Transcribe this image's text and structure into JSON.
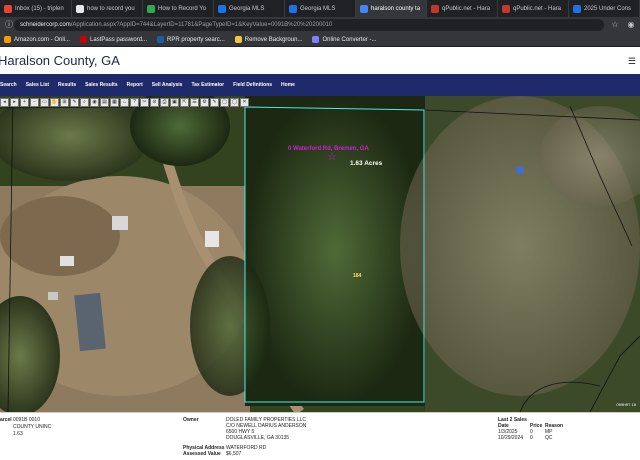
{
  "browser": {
    "tabs": [
      {
        "label": "Inbox (15) - triplen",
        "color": "#ea4335",
        "active": false
      },
      {
        "label": "how to record you",
        "color": "#e8e8e8",
        "active": false
      },
      {
        "label": "How to Record Yo",
        "color": "#34a853",
        "active": false
      },
      {
        "label": "Georgia MLS",
        "color": "#1a73e8",
        "active": false
      },
      {
        "label": "Georgia MLS",
        "color": "#1a73e8",
        "active": false
      },
      {
        "label": "haralson county ta",
        "color": "#4285f4",
        "active": true
      },
      {
        "label": "qPublic.net - Hara",
        "color": "#c0392b",
        "active": false
      },
      {
        "label": "qPublic.net - Hara",
        "color": "#c0392b",
        "active": false
      },
      {
        "label": "2025 Under Cons",
        "color": "#1a73e8",
        "active": false
      }
    ],
    "url_host": "schneidercorp.com",
    "url_path": "/Application.aspx?AppID=744&LayerID=11781&PageTypeID=1&KeyValue=0091B%20%20200010",
    "bookmarks": [
      {
        "label": "Amazon.com - Onli...",
        "color": "#ff9900"
      },
      {
        "label": "LastPass password...",
        "color": "#cc0000"
      },
      {
        "label": "RPR property searc...",
        "color": "#1a5fa6"
      },
      {
        "label": "Remove Backgroun...",
        "color": "#f6c445"
      },
      {
        "label": "Online Converter -...",
        "color": "#7f7fff"
      }
    ]
  },
  "site": {
    "title": "Haralson County, GA",
    "nav": [
      "Search",
      "Sales List",
      "Results",
      "Sales Results",
      "Report",
      "Sell Analysis",
      "Tax Estimator",
      "Field Definitions",
      "Home"
    ]
  },
  "map": {
    "tools": [
      "◂",
      "▸",
      "+",
      "−",
      "▭",
      "✋",
      "⊞",
      "✎",
      "⌕",
      "◉",
      "▤",
      "▦",
      "⌂",
      "?",
      "✂",
      "⊘",
      "⎙",
      "▣",
      "⇱",
      "☰",
      "⚙",
      "✎",
      "▢",
      "◯",
      "✕"
    ],
    "parcel_label": "0 Waterford Rd, Bremen, GA",
    "acres": "1.63 Acres",
    "parcel_number": "184",
    "corner_id": "099H97 18"
  },
  "details": {
    "parcel_label": "arcel",
    "parcel_id": "0091B 0010",
    "district": "COUNTY UNINC",
    "acres": "1.63",
    "owner_label": "Owner",
    "owner_lines": [
      "DOLED FAMILY PROPERTIES LLC",
      "C/O NEWELL DARIUS ANDERSON",
      "6500 HWY 5",
      "DOUGLASVILLE, GA 30135"
    ],
    "phys_addr_label": "Physical Address",
    "phys_addr": "WATERFORD RD",
    "assessed_label": "Assessed Value",
    "assessed_value": "$6,507",
    "sales_title": "Last 2 Sales",
    "sales_headers": [
      "Date",
      "Price",
      "Reason"
    ],
    "sales": [
      [
        "1/3/2025",
        "0",
        "MP"
      ],
      [
        "10/29/2024",
        "0",
        "QC"
      ]
    ]
  }
}
